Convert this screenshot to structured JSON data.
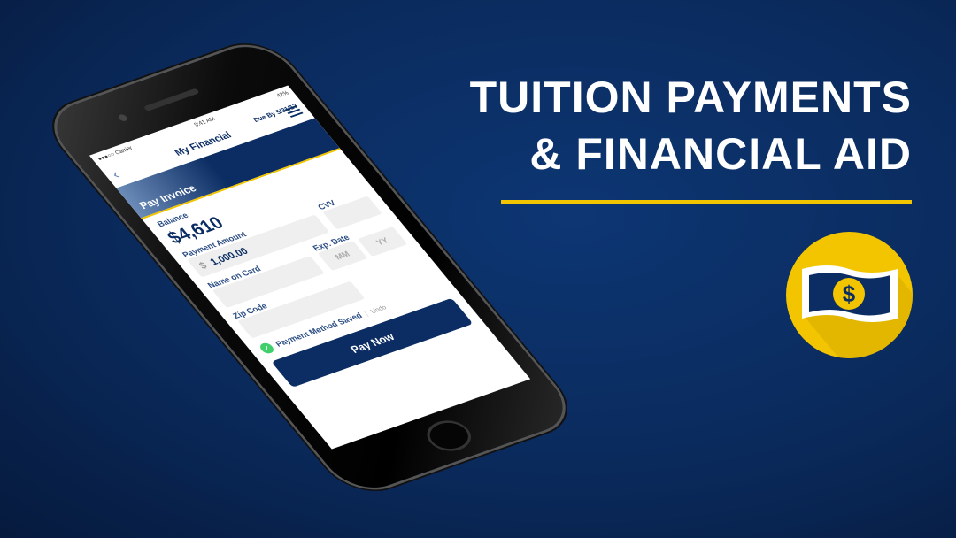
{
  "headline": {
    "line1": "TUITION PAYMENTS",
    "line2": "& FINANCIAL AID"
  },
  "colors": {
    "background": "#0a2a5c",
    "accent": "#f2c500",
    "brand": "#0b2d63",
    "success": "#3fcf6b"
  },
  "icon": "money-bill-dollar-icon",
  "app": {
    "status": {
      "carrier": "●●●○○ Carrier",
      "time": "9:41 AM",
      "battery": "42%"
    },
    "header": {
      "title": "My Financial"
    },
    "banner": {
      "title": "Pay Invoice",
      "due": "Due By 5/31/17"
    },
    "balance_label": "Balance",
    "balance": "$4,610",
    "payment_amount_label": "Payment Amount",
    "currency": "$",
    "payment_amount": "1,000.00",
    "cvv_label": "CVV",
    "name_label": "Name on Card",
    "exp_label": "Exp. Date",
    "mm_placeholder": "MM",
    "yy_placeholder": "YY",
    "zip_label": "Zip Code",
    "saved_label": "Payment Method Saved",
    "undo": "Undo",
    "pay_button": "Pay Now"
  }
}
